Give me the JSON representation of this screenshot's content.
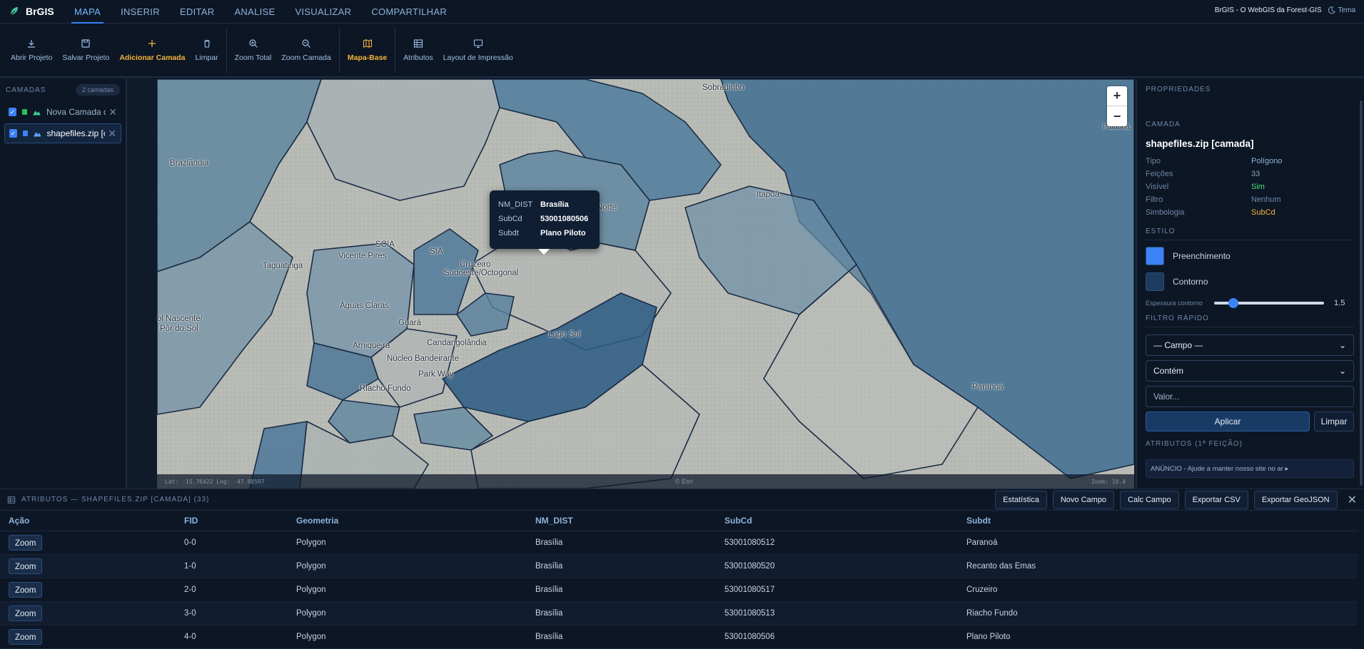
{
  "app": {
    "name": "BrGIS",
    "tagline": "BrGIS - O WebGIS da Forest-GIS",
    "theme_label": "Tema"
  },
  "menu": [
    "MAPA",
    "INSERIR",
    "EDITAR",
    "ANALISE",
    "VISUALIZAR",
    "COMPARTILHAR"
  ],
  "ribbon": {
    "abrir": "Abrir Projeto",
    "salvar": "Salvar Projeto",
    "adicionar": "Adicionar Camada",
    "limpar": "Limpar",
    "zoom_total": "Zoom Total",
    "zoom_camada": "Zoom Camada",
    "mapa_base": "Mapa-Base",
    "atributos": "Atributos",
    "layout": "Layout de Impressão"
  },
  "layers": {
    "title": "CAMADAS",
    "count": "2 camadas",
    "items": [
      {
        "name": "Nova Camada d...",
        "color": "#22c55e"
      },
      {
        "name": "shapefiles.zip [c...",
        "color": "#3b82f6"
      }
    ]
  },
  "map": {
    "labels": {
      "sobradinho": "Sobradinho",
      "paranoa_cut": "Paranoá",
      "brazlandia": "Brazlândia",
      "itapoa": "Itapoã",
      "norte": "Norte",
      "scia": "SCIA",
      "sia": "SIA",
      "plano_piloto": "Plano Piloto",
      "taguatinga": "Taguatinga",
      "vicente_pires": "Vicente Pires",
      "cruzeiro": "Cruzeiro",
      "sudoeste": "Sudoeste/Octogonal",
      "aguas_claras": "Águas Claras",
      "sol_nascente": "ol Nascente/",
      "por_do_sol": "Pôr do Sol",
      "guara": "Guará",
      "arniqueira": "Arniqueira",
      "candangolandia": "Candangolândia",
      "lago_sul": "Lago Sul",
      "nucleo": "Núcleo Bandeirante",
      "park_way": "Park Way",
      "riacho_fundo": "Riacho Fundo",
      "paranoa": "Paranoá"
    },
    "popup": {
      "rows": [
        {
          "k": "NM_DIST",
          "v": "Brasília"
        },
        {
          "k": "SubCd",
          "v": "53001080506"
        },
        {
          "k": "Subdt",
          "v": "Plano Piloto"
        }
      ]
    },
    "status": {
      "coords": "Lat: -15.76422  Lng: -47.88597",
      "attribution": "© Esri",
      "zoom": "Zoom: 10.4"
    }
  },
  "props": {
    "title": "PROPRIEDADES",
    "section_layer": "CAMADA",
    "layer_name": "shapefiles.zip [camada]",
    "rows": [
      {
        "k": "Tipo",
        "v": "Polígono",
        "color": "#8fb3d9"
      },
      {
        "k": "Feições",
        "v": "33",
        "color": "#8fa6c2"
      },
      {
        "k": "Visível",
        "v": "Sim",
        "color": "#4ade80"
      },
      {
        "k": "Filtro",
        "v": "Nenhum",
        "color": "#6f87a6"
      },
      {
        "k": "Simbologia",
        "v": "SubCd",
        "color": "#f5b53a"
      }
    ],
    "style_title": "ESTILO",
    "fill_label": "Preenchimento",
    "fill_color": "#3b82f6",
    "stroke_label": "Contorno",
    "stroke_color": "#1e3a5f",
    "thickness_label": "Espessura contorno",
    "thickness_value": "1.5",
    "thickness_fraction": 0.14,
    "filter_title": "FILTRO RÁPIDO",
    "field_select": "— Campo —",
    "op_select": "Contém",
    "value_placeholder": "Valor...",
    "apply": "Aplicar",
    "clear": "Limpar",
    "attr_title": "ATRIBUTOS (1ª FEIÇÃO)",
    "ad": "ANÚNCIO - Ajude a manter nosso site no ar ▸"
  },
  "attr": {
    "title": "ATRIBUTOS — SHAPEFILES.ZIP [CAMADA] (33)",
    "buttons": [
      "Estatística",
      "Novo Campo",
      "Calc Campo",
      "Exportar CSV",
      "Exportar GeoJSON"
    ],
    "columns": [
      "Ação",
      "FID",
      "Geometria",
      "NM_DIST",
      "SubCd",
      "Subdt"
    ],
    "zoom_label": "Zoom",
    "rows": [
      [
        "0-0",
        "Polygon",
        "Brasília",
        "53001080512",
        "Paranoá"
      ],
      [
        "1-0",
        "Polygon",
        "Brasília",
        "53001080520",
        "Recanto das Emas"
      ],
      [
        "2-0",
        "Polygon",
        "Brasília",
        "53001080517",
        "Cruzeiro"
      ],
      [
        "3-0",
        "Polygon",
        "Brasília",
        "53001080513",
        "Riacho Fundo"
      ],
      [
        "4-0",
        "Polygon",
        "Brasília",
        "53001080506",
        "Plano Piloto"
      ]
    ]
  }
}
